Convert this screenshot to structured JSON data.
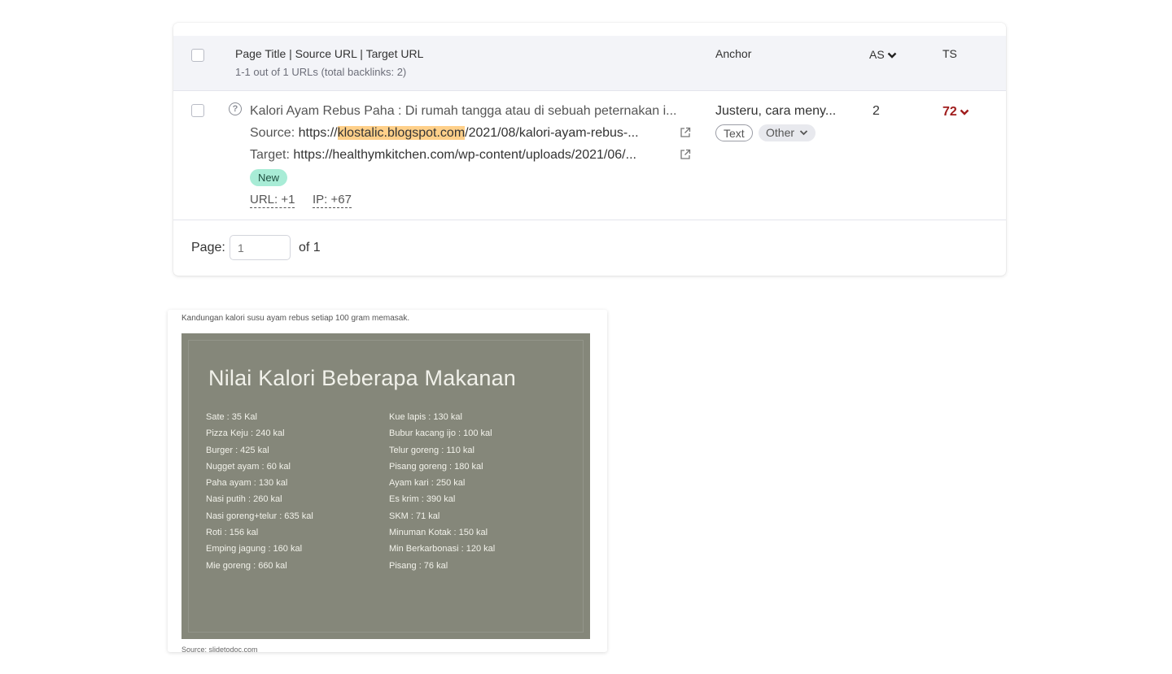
{
  "table": {
    "header": {
      "title": "Page Title | Source URL | Target URL",
      "subtitle": "1-1 out of 1 URLs (total backlinks: 2)",
      "anchor": "Anchor",
      "as": "AS",
      "ts": "TS"
    },
    "row": {
      "title": "Kalori Ayam Rebus Paha : Di rumah tangga atau di sebuah peternakan i...",
      "source_label": "Source:",
      "source_prefix": "https://",
      "source_domain": "klostalic.blogspot.com",
      "source_path": "/2021/08/kalori-ayam-rebus-...",
      "target_label": "Target:",
      "target_url": "https://healthymkitchen.com/wp-content/uploads/2021/06/...",
      "badge": "New",
      "url_stat": "URL: +1",
      "ip_stat": "IP: +67",
      "anchor_text": "Justeru, cara meny...",
      "tag_text": "Text",
      "tag_other": "Other",
      "as_value": "2",
      "ts_value": "72"
    },
    "pager": {
      "label": "Page:",
      "placeholder": "1",
      "of": "of 1"
    }
  },
  "image_card": {
    "caption": "Kandungan kalori susu ayam rebus setiap 100 gram memasak.",
    "image_title": "Nilai Kalori Beberapa Makanan",
    "left_column": [
      "Sate : 35 Kal",
      "Pizza Keju : 240 kal",
      "Burger : 425 kal",
      "Nugget ayam : 60 kal",
      "Paha ayam : 130 kal",
      "Nasi putih : 260 kal",
      "Nasi goreng+telur : 635 kal",
      "Roti : 156 kal",
      "Emping jagung : 160 kal",
      "Mie goreng : 660 kal"
    ],
    "right_column": [
      "Kue lapis : 130 kal",
      "Bubur kacang ijo : 100 kal",
      "Telur goreng : 110 kal",
      "Pisang goreng : 180 kal",
      "Ayam kari : 250 kal",
      "Es krim : 390 kal",
      "SKM : 71 kal",
      "Minuman Kotak : 150 kal",
      "Min Berkarbonasi : 120 kal",
      "Pisang : 76 kal"
    ],
    "source": "Source: slidetodoc.com"
  },
  "colors": {
    "highlight": "#ffd08a",
    "ts_red": "#a01d1d",
    "badge_new": "#a8ecd6",
    "image_bg": "#85877a"
  }
}
